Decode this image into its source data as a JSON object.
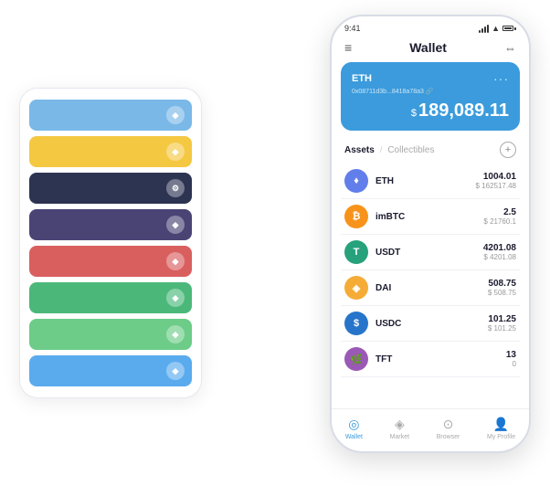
{
  "scene": {
    "background": "#ffffff"
  },
  "card_stack": {
    "cards": [
      {
        "color": "#7ab8e8",
        "icon_text": "◆"
      },
      {
        "color": "#f5c842",
        "icon_text": "◆"
      },
      {
        "color": "#2d3452",
        "icon_text": "⚙"
      },
      {
        "color": "#4a4475",
        "icon_text": "◆"
      },
      {
        "color": "#d95f5f",
        "icon_text": "◆"
      },
      {
        "color": "#4bb87a",
        "icon_text": "◆"
      },
      {
        "color": "#6ccc88",
        "icon_text": "◆"
      },
      {
        "color": "#5aabee",
        "icon_text": "◆"
      }
    ]
  },
  "phone": {
    "status_bar": {
      "time": "9:41",
      "signal": true,
      "wifi": true,
      "battery": true
    },
    "header": {
      "menu_icon": "≡",
      "title": "Wallet",
      "expand_icon": "⇔"
    },
    "eth_card": {
      "label": "ETH",
      "address": "0x08711d3b...8418a78a3 🔗",
      "currency_symbol": "$",
      "balance": "189,089.11",
      "dots": "···"
    },
    "assets_section": {
      "tab_active": "Assets",
      "tab_divider": "/",
      "tab_collectibles": "Collectibles",
      "add_icon": "+"
    },
    "assets": [
      {
        "name": "ETH",
        "amount": "1004.01",
        "usd": "$ 162517.48",
        "icon_color": "#627eea",
        "icon_text": "♦"
      },
      {
        "name": "imBTC",
        "amount": "2.5",
        "usd": "$ 21760.1",
        "icon_color": "#f7931a",
        "icon_text": "₿"
      },
      {
        "name": "USDT",
        "amount": "4201.08",
        "usd": "$ 4201.08",
        "icon_color": "#26a17b",
        "icon_text": "T"
      },
      {
        "name": "DAI",
        "amount": "508.75",
        "usd": "$ 508.75",
        "icon_color": "#f5ac37",
        "icon_text": "◈"
      },
      {
        "name": "USDC",
        "amount": "101.25",
        "usd": "$ 101.25",
        "icon_color": "#2775ca",
        "icon_text": "$"
      },
      {
        "name": "TFT",
        "amount": "13",
        "usd": "0",
        "icon_color": "#9b59b6",
        "icon_text": "🌿"
      }
    ],
    "bottom_nav": [
      {
        "icon": "◎",
        "label": "Wallet",
        "active": true
      },
      {
        "icon": "◈",
        "label": "Market",
        "active": false
      },
      {
        "icon": "⊙",
        "label": "Browser",
        "active": false
      },
      {
        "icon": "👤",
        "label": "My Profile",
        "active": false
      }
    ]
  }
}
